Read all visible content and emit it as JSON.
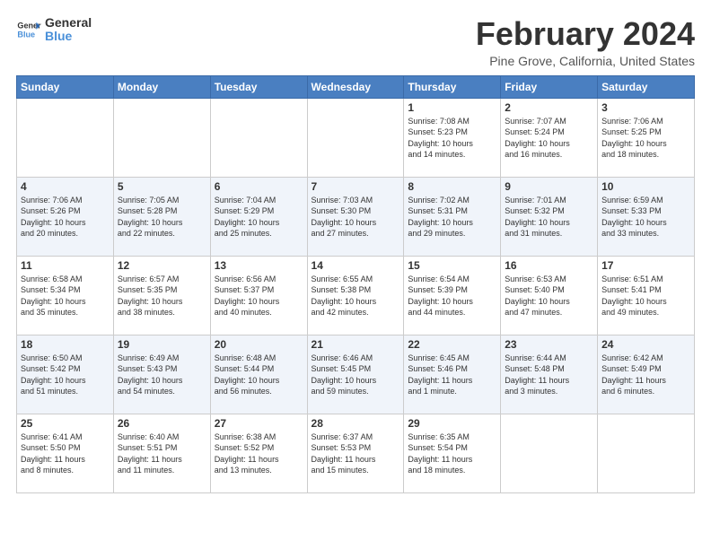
{
  "logo": {
    "line1": "General",
    "line2": "Blue"
  },
  "title": "February 2024",
  "location": "Pine Grove, California, United States",
  "days_of_week": [
    "Sunday",
    "Monday",
    "Tuesday",
    "Wednesday",
    "Thursday",
    "Friday",
    "Saturday"
  ],
  "weeks": [
    [
      {
        "day": "",
        "info": ""
      },
      {
        "day": "",
        "info": ""
      },
      {
        "day": "",
        "info": ""
      },
      {
        "day": "",
        "info": ""
      },
      {
        "day": "1",
        "info": "Sunrise: 7:08 AM\nSunset: 5:23 PM\nDaylight: 10 hours\nand 14 minutes."
      },
      {
        "day": "2",
        "info": "Sunrise: 7:07 AM\nSunset: 5:24 PM\nDaylight: 10 hours\nand 16 minutes."
      },
      {
        "day": "3",
        "info": "Sunrise: 7:06 AM\nSunset: 5:25 PM\nDaylight: 10 hours\nand 18 minutes."
      }
    ],
    [
      {
        "day": "4",
        "info": "Sunrise: 7:06 AM\nSunset: 5:26 PM\nDaylight: 10 hours\nand 20 minutes."
      },
      {
        "day": "5",
        "info": "Sunrise: 7:05 AM\nSunset: 5:28 PM\nDaylight: 10 hours\nand 22 minutes."
      },
      {
        "day": "6",
        "info": "Sunrise: 7:04 AM\nSunset: 5:29 PM\nDaylight: 10 hours\nand 25 minutes."
      },
      {
        "day": "7",
        "info": "Sunrise: 7:03 AM\nSunset: 5:30 PM\nDaylight: 10 hours\nand 27 minutes."
      },
      {
        "day": "8",
        "info": "Sunrise: 7:02 AM\nSunset: 5:31 PM\nDaylight: 10 hours\nand 29 minutes."
      },
      {
        "day": "9",
        "info": "Sunrise: 7:01 AM\nSunset: 5:32 PM\nDaylight: 10 hours\nand 31 minutes."
      },
      {
        "day": "10",
        "info": "Sunrise: 6:59 AM\nSunset: 5:33 PM\nDaylight: 10 hours\nand 33 minutes."
      }
    ],
    [
      {
        "day": "11",
        "info": "Sunrise: 6:58 AM\nSunset: 5:34 PM\nDaylight: 10 hours\nand 35 minutes."
      },
      {
        "day": "12",
        "info": "Sunrise: 6:57 AM\nSunset: 5:35 PM\nDaylight: 10 hours\nand 38 minutes."
      },
      {
        "day": "13",
        "info": "Sunrise: 6:56 AM\nSunset: 5:37 PM\nDaylight: 10 hours\nand 40 minutes."
      },
      {
        "day": "14",
        "info": "Sunrise: 6:55 AM\nSunset: 5:38 PM\nDaylight: 10 hours\nand 42 minutes."
      },
      {
        "day": "15",
        "info": "Sunrise: 6:54 AM\nSunset: 5:39 PM\nDaylight: 10 hours\nand 44 minutes."
      },
      {
        "day": "16",
        "info": "Sunrise: 6:53 AM\nSunset: 5:40 PM\nDaylight: 10 hours\nand 47 minutes."
      },
      {
        "day": "17",
        "info": "Sunrise: 6:51 AM\nSunset: 5:41 PM\nDaylight: 10 hours\nand 49 minutes."
      }
    ],
    [
      {
        "day": "18",
        "info": "Sunrise: 6:50 AM\nSunset: 5:42 PM\nDaylight: 10 hours\nand 51 minutes."
      },
      {
        "day": "19",
        "info": "Sunrise: 6:49 AM\nSunset: 5:43 PM\nDaylight: 10 hours\nand 54 minutes."
      },
      {
        "day": "20",
        "info": "Sunrise: 6:48 AM\nSunset: 5:44 PM\nDaylight: 10 hours\nand 56 minutes."
      },
      {
        "day": "21",
        "info": "Sunrise: 6:46 AM\nSunset: 5:45 PM\nDaylight: 10 hours\nand 59 minutes."
      },
      {
        "day": "22",
        "info": "Sunrise: 6:45 AM\nSunset: 5:46 PM\nDaylight: 11 hours\nand 1 minute."
      },
      {
        "day": "23",
        "info": "Sunrise: 6:44 AM\nSunset: 5:48 PM\nDaylight: 11 hours\nand 3 minutes."
      },
      {
        "day": "24",
        "info": "Sunrise: 6:42 AM\nSunset: 5:49 PM\nDaylight: 11 hours\nand 6 minutes."
      }
    ],
    [
      {
        "day": "25",
        "info": "Sunrise: 6:41 AM\nSunset: 5:50 PM\nDaylight: 11 hours\nand 8 minutes."
      },
      {
        "day": "26",
        "info": "Sunrise: 6:40 AM\nSunset: 5:51 PM\nDaylight: 11 hours\nand 11 minutes."
      },
      {
        "day": "27",
        "info": "Sunrise: 6:38 AM\nSunset: 5:52 PM\nDaylight: 11 hours\nand 13 minutes."
      },
      {
        "day": "28",
        "info": "Sunrise: 6:37 AM\nSunset: 5:53 PM\nDaylight: 11 hours\nand 15 minutes."
      },
      {
        "day": "29",
        "info": "Sunrise: 6:35 AM\nSunset: 5:54 PM\nDaylight: 11 hours\nand 18 minutes."
      },
      {
        "day": "",
        "info": ""
      },
      {
        "day": "",
        "info": ""
      }
    ]
  ]
}
